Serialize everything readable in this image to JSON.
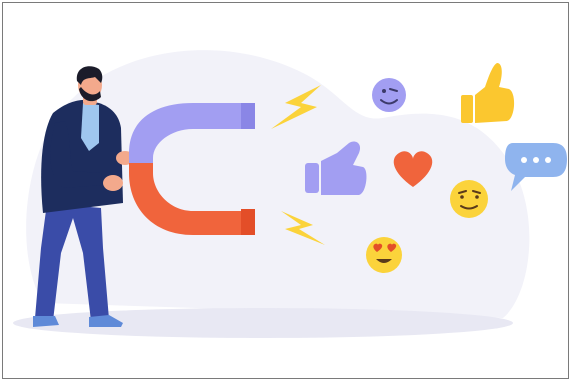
{
  "illustration": {
    "subject": "customer-attraction",
    "icons": [
      "magnet-icon",
      "lightning-bolt-icon",
      "thumbs-up-icon",
      "heart-icon",
      "chat-bubble-icon",
      "smiley-face-icon",
      "wink-face-icon",
      "heart-eyes-face-icon"
    ]
  },
  "colors": {
    "blob": "#f2f2f9",
    "floor": "#e8e8f3",
    "magnet_top": "#a29ef2",
    "magnet_bottom": "#f0643c",
    "magnet_tip_dark": "#8a86e6",
    "magnet_tip_red": "#e34e28",
    "emoji_yellow": "#fbd33b",
    "thumb_yellow": "#fbc72f",
    "thumb_purple": "#a29ef2",
    "heart": "#f0643c",
    "chat_blue": "#8fb4ee",
    "lightning": "#fbd33b",
    "jacket": "#1d2d5e",
    "pants": "#3a4ca8",
    "shirt": "#9fc6ef",
    "skin": "#f3a98c",
    "hair": "#1b1c2a",
    "shoes": "#5f8ad8"
  }
}
